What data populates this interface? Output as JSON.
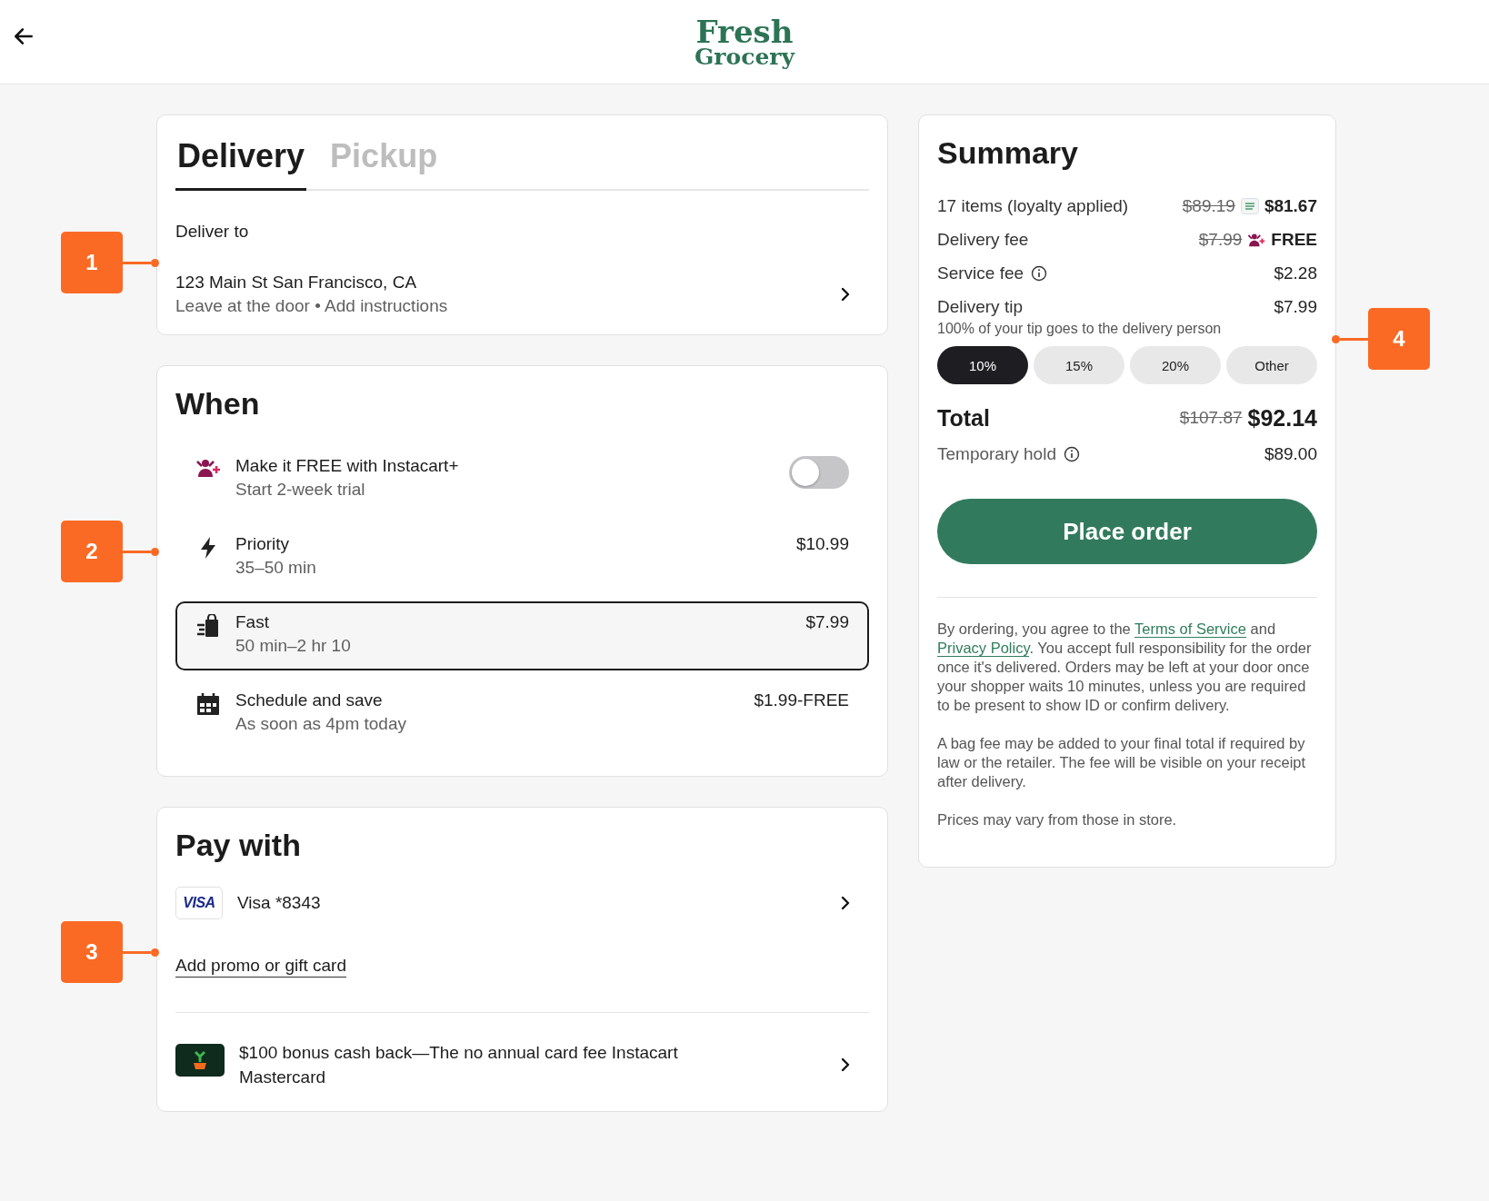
{
  "header": {
    "logo_line1": "Fresh",
    "logo_line2": "Grocery"
  },
  "fulfillment_tabs": [
    {
      "label": "Delivery",
      "selected": true
    },
    {
      "label": "Pickup",
      "selected": false
    }
  ],
  "address": {
    "label": "Deliver to",
    "line": "123 Main St San Francisco, CA",
    "note": "Leave at the door • Add instructions"
  },
  "when": {
    "title": "When",
    "options": [
      {
        "kind": "membership",
        "title": "Make it FREE with Instacart+",
        "subtitle": "Start 2-week trial",
        "on": false,
        "selected": false
      },
      {
        "kind": "priority",
        "title": "Priority",
        "subtitle": "35–50 min",
        "price": "$10.99",
        "selected": false
      },
      {
        "kind": "fast",
        "title": "Fast",
        "subtitle": "50 min–2 hr 10",
        "price": "$7.99",
        "selected": true
      },
      {
        "kind": "schedule",
        "title": "Schedule and save",
        "subtitle": "As soon as 4pm today",
        "price": "$1.99-FREE",
        "selected": false
      }
    ]
  },
  "payment": {
    "title": "Pay with",
    "card_brand": "VISA",
    "card_label": "Visa *8343",
    "promo_link": "Add promo or gift card",
    "offer": "$100 bonus cash back—The no annual card fee Instacart Mastercard"
  },
  "summary": {
    "title": "Summary",
    "lines": [
      {
        "label": "17 items (loyalty applied)",
        "was": "$89.19",
        "kind": "store",
        "value": "$81.67",
        "info": false
      },
      {
        "label": "Delivery fee",
        "was": "$7.99",
        "kind": "plus",
        "value": "FREE",
        "info": false
      },
      {
        "label": "Service fee",
        "kind": "plain",
        "value": "$2.28",
        "info": true
      }
    ],
    "tip": {
      "label": "Delivery tip",
      "value": "$7.99",
      "note": "100% of your tip goes to the delivery person",
      "options": [
        {
          "label": "10%",
          "selected": true
        },
        {
          "label": "15%",
          "selected": false
        },
        {
          "label": "20%",
          "selected": false
        },
        {
          "label": "Other",
          "selected": false
        }
      ]
    },
    "total": {
      "label": "Total",
      "was": "$107.87",
      "value": "$92.14"
    },
    "hold": {
      "label": "Temporary hold",
      "value": "$89.00",
      "info": true
    },
    "button": "Place order",
    "legal": {
      "before": "By ordering, you agree to the ",
      "terms_link": "Terms of Service",
      "middle": " and ",
      "privacy_link": "Privacy Policy",
      "after": ". You accept full responsibility for the order once it's delivered. Orders may be left at your door once your shopper waits 10 minutes, unless you are required to be present to show ID or confirm delivery."
    },
    "notes": [
      "A bag fee may be added to your final total if required by law or the retailer. The fee will be visible on your receipt after delivery.",
      "Prices may vary from those in store."
    ]
  },
  "callouts": [
    "1",
    "2",
    "3",
    "4"
  ]
}
